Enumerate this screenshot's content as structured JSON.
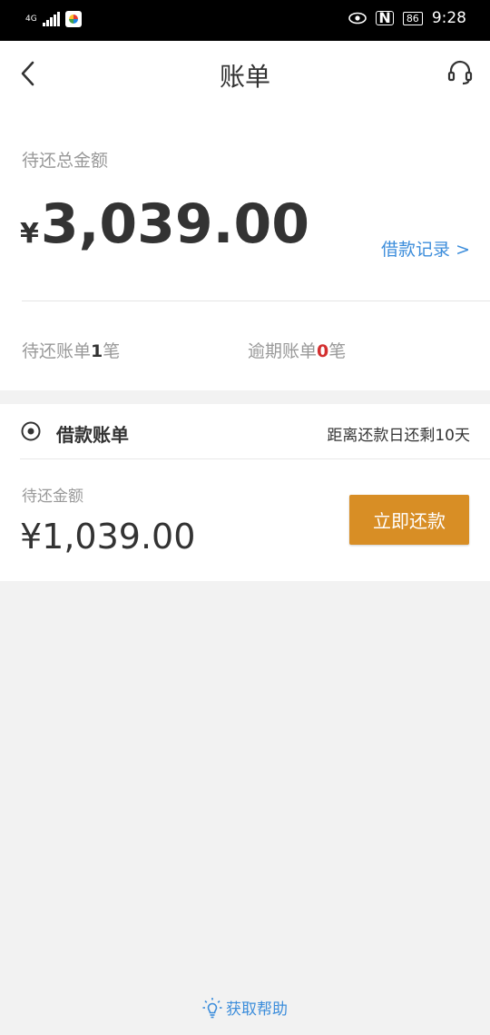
{
  "status_bar": {
    "network": "4G",
    "battery": "86",
    "time": "9:28"
  },
  "header": {
    "title": "账单"
  },
  "summary": {
    "label": "待还总金额",
    "currency": "¥",
    "amount": "3,039.00",
    "loan_record_link": "借款记录 >",
    "bill_count_prefix": "待还账单",
    "bill_count": "1",
    "bill_count_suffix": "笔",
    "overdue_prefix": "逾期账单",
    "overdue_count": "0",
    "overdue_suffix": "笔"
  },
  "loan_card": {
    "title": "借款账单",
    "due_info": "距离还款日还剩10天",
    "due_label": "待还金额",
    "due_amount": "¥1,039.00",
    "repay_button": "立即还款"
  },
  "footer": {
    "help_label": "获取帮助"
  },
  "colors": {
    "accent_blue": "#3c8ddb",
    "repay_orange": "#d88e25",
    "overdue_red": "#d32f2f"
  }
}
